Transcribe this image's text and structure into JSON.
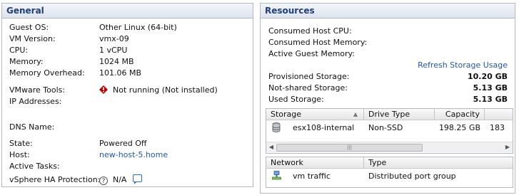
{
  "general": {
    "title": "General",
    "rows": [
      {
        "label": "Guest OS:",
        "value": "Other Linux (64-bit)"
      },
      {
        "label": "VM Version:",
        "value": "vmx-09"
      },
      {
        "label": "CPU:",
        "value": "1 vCPU"
      },
      {
        "label": "Memory:",
        "value": "1024 MB"
      },
      {
        "label": "Memory Overhead:",
        "value": "101.06 MB"
      }
    ],
    "vmware_tools_label": "VMware Tools:",
    "vmware_tools_value": "Not running (Not installed)",
    "ip_addresses_label": "IP Addresses:",
    "dns_name_label": "DNS Name:",
    "state_label": "State:",
    "state_value": "Powered Off",
    "host_label": "Host:",
    "host_value": "new-host-5.home",
    "active_tasks_label": "Active Tasks:",
    "ha_label": "vSphere HA Protection:",
    "ha_value": "N/A",
    "icons": {
      "tools_status": "error-icon",
      "ha_help": "help-icon",
      "ha_details": "speech-bubble-icon"
    },
    "colors": {
      "error": "#c00000",
      "link": "#1f55b8"
    }
  },
  "resources": {
    "title": "Resources",
    "consumed_cpu_label": "Consumed Host CPU:",
    "consumed_memory_label": "Consumed Host Memory:",
    "active_guest_memory_label": "Active Guest Memory:",
    "refresh_link": "Refresh Storage Usage",
    "provisioned_label": "Provisioned Storage:",
    "provisioned_value": "10.20 GB",
    "not_shared_label": "Not-shared Storage:",
    "not_shared_value": "5.13 GB",
    "used_label": "Used Storage:",
    "used_value": "5.13 GB",
    "storage_table": {
      "headers": {
        "storage": "Storage",
        "drive_type": "Drive Type",
        "capacity": "Capacity"
      },
      "rows": [
        {
          "name": "esx108-internal",
          "drive_type": "Non-SSD",
          "capacity": "198.25 GB",
          "extra": "183"
        }
      ]
    },
    "network_table": {
      "headers": {
        "network": "Network",
        "type": "Type"
      },
      "rows": [
        {
          "name": "vm traffic",
          "type": "Distributed port group"
        }
      ]
    },
    "icons": {
      "datastore": "database-icon",
      "network": "network-icon",
      "sort": "sort-ascending-icon"
    }
  }
}
